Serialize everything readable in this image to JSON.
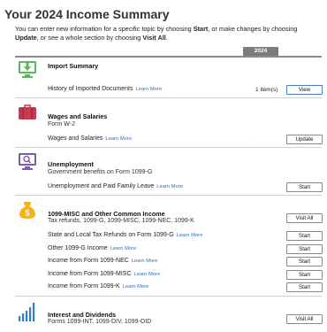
{
  "page": {
    "title": "Your 2024 Income Summary",
    "intro_1": "You can enter new information for a specific topic by choosing ",
    "intro_start": "Start",
    "intro_2": ", or make changes by choosing ",
    "intro_update": "Update",
    "intro_3": ", or see a whole section by choosing ",
    "intro_visit": "Visit All",
    "intro_4": ".",
    "year_tab": "2024"
  },
  "learn_more": "Learn More",
  "sections": {
    "import": {
      "title": "Import Summary",
      "icon": "download-monitor-icon",
      "color": "#5cb85c",
      "row_label": "History of Imported Documents",
      "row_count": "1 item(s)",
      "row_button": "View"
    },
    "wages": {
      "title": "Wages and Salaries",
      "subtitle": "Form W-2",
      "icon": "briefcase-icon",
      "color": "#c8384f",
      "row_label": "Wages and Salaries",
      "row_button": "Update"
    },
    "unemployment": {
      "title": "Unemployment",
      "subtitle": "Government benefits on Form 1099-G",
      "icon": "magnifier-monitor-icon",
      "color": "#7a5fa8",
      "row_label": "Unemployment and Paid Family Leave",
      "row_button": "Start"
    },
    "misc": {
      "title": "1099-MISC and Other Common Income",
      "subtitle": "Tax refunds, 1099-G, 1099-MISC, 1099-NEC, 1099-K",
      "icon": "money-bag-icon",
      "color": "#f2b417",
      "header_button": "Visit All",
      "rows": [
        {
          "label": "State and Local Tax Refunds on Form 1099-G",
          "button": "Start"
        },
        {
          "label": "Other 1099-G Income",
          "button": "Start"
        },
        {
          "label": "Income from Form 1099-NEC",
          "button": "Start"
        },
        {
          "label": "Income from Form 1099-MISC",
          "button": "Start"
        },
        {
          "label": "Income from Form 1099-K",
          "button": "Start"
        }
      ]
    },
    "interest": {
      "title": "Interest and Dividends",
      "subtitle": "Forms 1099-INT, 1099-DIV, 1099-OID",
      "icon": "bar-chart-icon",
      "color": "#2f7fd0",
      "header_button": "Visit All"
    }
  }
}
